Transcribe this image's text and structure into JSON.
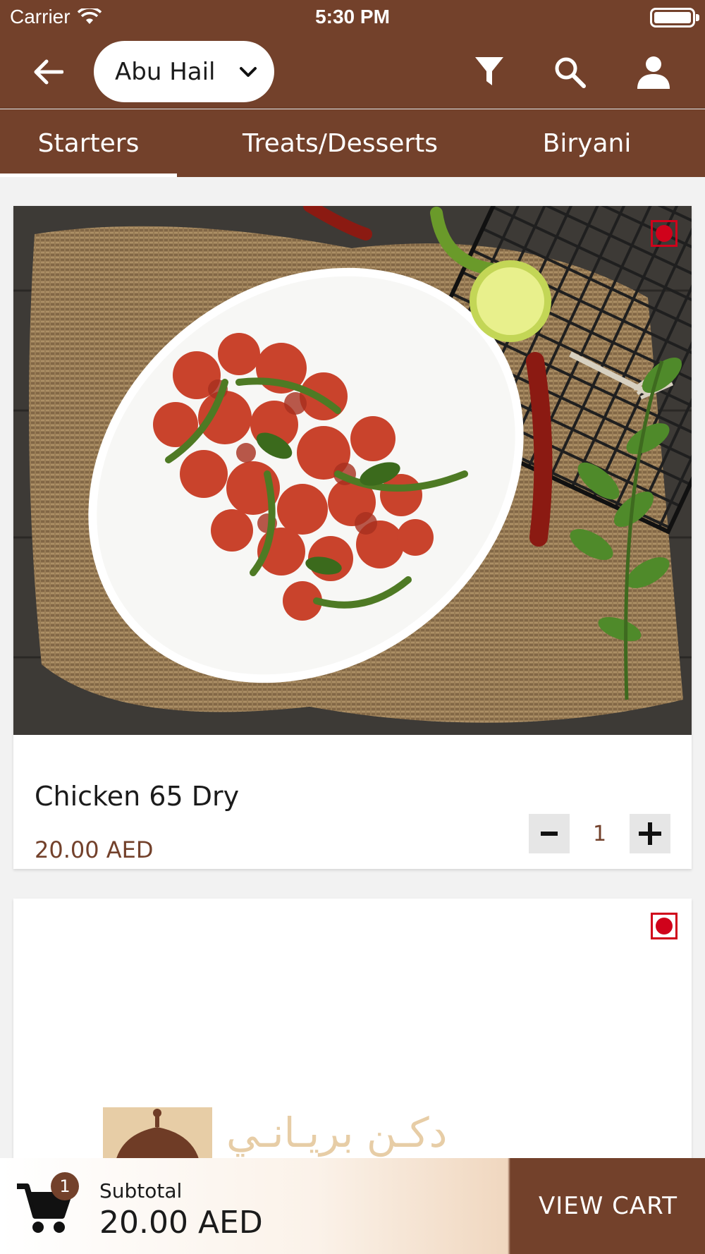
{
  "status_bar": {
    "carrier": "Carrier",
    "time": "5:30 PM"
  },
  "header": {
    "back_icon": "arrow-left-icon",
    "location": "Abu Hail",
    "filter_icon": "filter-icon",
    "search_icon": "search-icon",
    "profile_icon": "person-icon"
  },
  "tabs": [
    {
      "label": "Starters",
      "active": true
    },
    {
      "label": "Treats/Desserts",
      "active": false
    },
    {
      "label": "Biryani",
      "active": false
    }
  ],
  "items": [
    {
      "name": "Chicken 65 Dry",
      "price": "20.00 AED",
      "quantity": "1",
      "type": "non-veg"
    },
    {
      "name": "",
      "price": "",
      "quantity": "",
      "type": "non-veg",
      "logo_text": "دكـن بريـانـي"
    }
  ],
  "cart": {
    "count": "1",
    "subtotal_label": "Subtotal",
    "subtotal_value": "20.00 AED",
    "button_label": "VIEW CART"
  },
  "colors": {
    "brand": "#73412b",
    "badge_red": "#d0021b"
  }
}
